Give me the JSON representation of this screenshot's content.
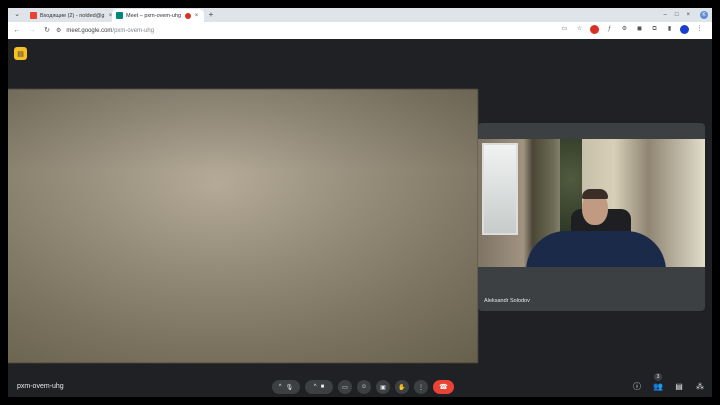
{
  "browser": {
    "tabs": [
      {
        "title": "Входящие (2) - nolded@g",
        "close": "×",
        "active": false,
        "icon_color": "#ea4335"
      },
      {
        "title": "Meet – pxm-ovem-uhg",
        "close": "×",
        "active": true,
        "icon_color": "#00897b"
      }
    ],
    "new_tab": "+",
    "window_controls": [
      "–",
      "□",
      "×"
    ],
    "profile_initial": "K",
    "url_host": "meet.google.com",
    "url_path": "/pxm-ovem-uhg"
  },
  "meet": {
    "side_tile_name": "Aleksandr Solodov",
    "meeting_code": "pxm-ovem-uhg",
    "participants_count": "3"
  },
  "colors": {
    "end_call": "#ea4335",
    "badge": "#f6bf26",
    "background": "#202124"
  }
}
